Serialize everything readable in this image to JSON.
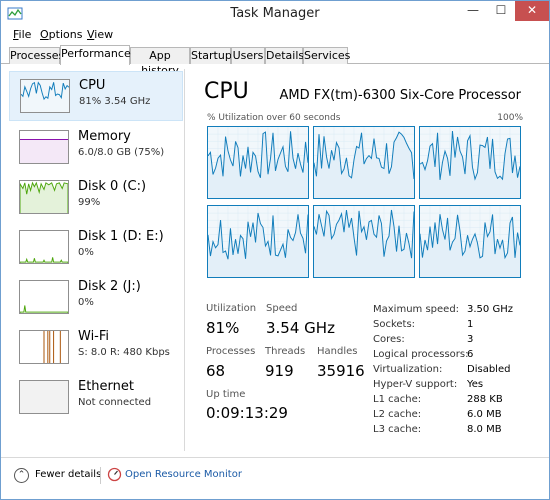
{
  "window": {
    "title": "Task Manager",
    "min_icon": "minimize-icon",
    "max_icon": "maximize-icon",
    "close_icon": "close-icon"
  },
  "menu": [
    {
      "label": "File",
      "underline": "F",
      "rest": "ile"
    },
    {
      "label": "Options",
      "underline": "O",
      "rest": "ptions"
    },
    {
      "label": "View",
      "underline": "V",
      "rest": "iew"
    }
  ],
  "tabs": [
    {
      "label": "Processes"
    },
    {
      "label": "Performance",
      "active": true
    },
    {
      "label": "App history"
    },
    {
      "label": "Startup"
    },
    {
      "label": "Users"
    },
    {
      "label": "Details"
    },
    {
      "label": "Services"
    }
  ],
  "sidebar": [
    {
      "name": "CPU",
      "sub": "81%  3.54 GHz",
      "active": true,
      "color": "#117dbb"
    },
    {
      "name": "Memory",
      "sub": "6.0/8.0 GB (75%)",
      "color": "#8b12ae"
    },
    {
      "name": "Disk 0 (C:)",
      "sub": "99%",
      "color": "#4da60c"
    },
    {
      "name": "Disk 1 (D: E:)",
      "sub": "0%",
      "color": "#4da60c"
    },
    {
      "name": "Disk 2 (J:)",
      "sub": "0%",
      "color": "#4da60c"
    },
    {
      "name": "Wi-Fi",
      "sub": "S: 8.0  R: 480 Kbps",
      "color": "#a74f01"
    },
    {
      "name": "Ethernet",
      "sub": "Not connected",
      "color": "#a74f01"
    }
  ],
  "main": {
    "title": "CPU",
    "model": "AMD FX(tm)-6300 Six-Core Processor",
    "graph_caption": "% Utilization over 60 seconds",
    "graph_max": "100%",
    "graph_color": "#117dbb",
    "stats": {
      "utilization_label": "Utilization",
      "utilization_value": "81%",
      "speed_label": "Speed",
      "speed_value": "3.54 GHz",
      "processes_label": "Processes",
      "processes_value": "68",
      "threads_label": "Threads",
      "threads_value": "919",
      "handles_label": "Handles",
      "handles_value": "35916",
      "uptime_label": "Up time",
      "uptime_value": "0:09:13:29"
    },
    "specs": [
      {
        "key": "Maximum speed:",
        "value": "3.50 GHz"
      },
      {
        "key": "Sockets:",
        "value": "1"
      },
      {
        "key": "Cores:",
        "value": "3"
      },
      {
        "key": "Logical processors:",
        "value": "6"
      },
      {
        "key": "Virtualization:",
        "value": "Disabled"
      },
      {
        "key": "Hyper-V support:",
        "value": "Yes"
      },
      {
        "key": "L1 cache:",
        "value": "288 KB"
      },
      {
        "key": "L2 cache:",
        "value": "6.0 MB"
      },
      {
        "key": "L3 cache:",
        "value": "8.0 MB"
      }
    ]
  },
  "footer": {
    "fewer_details": "Fewer details",
    "fewer_underline": "d",
    "open_monitor": "Open Resource Monitor"
  }
}
